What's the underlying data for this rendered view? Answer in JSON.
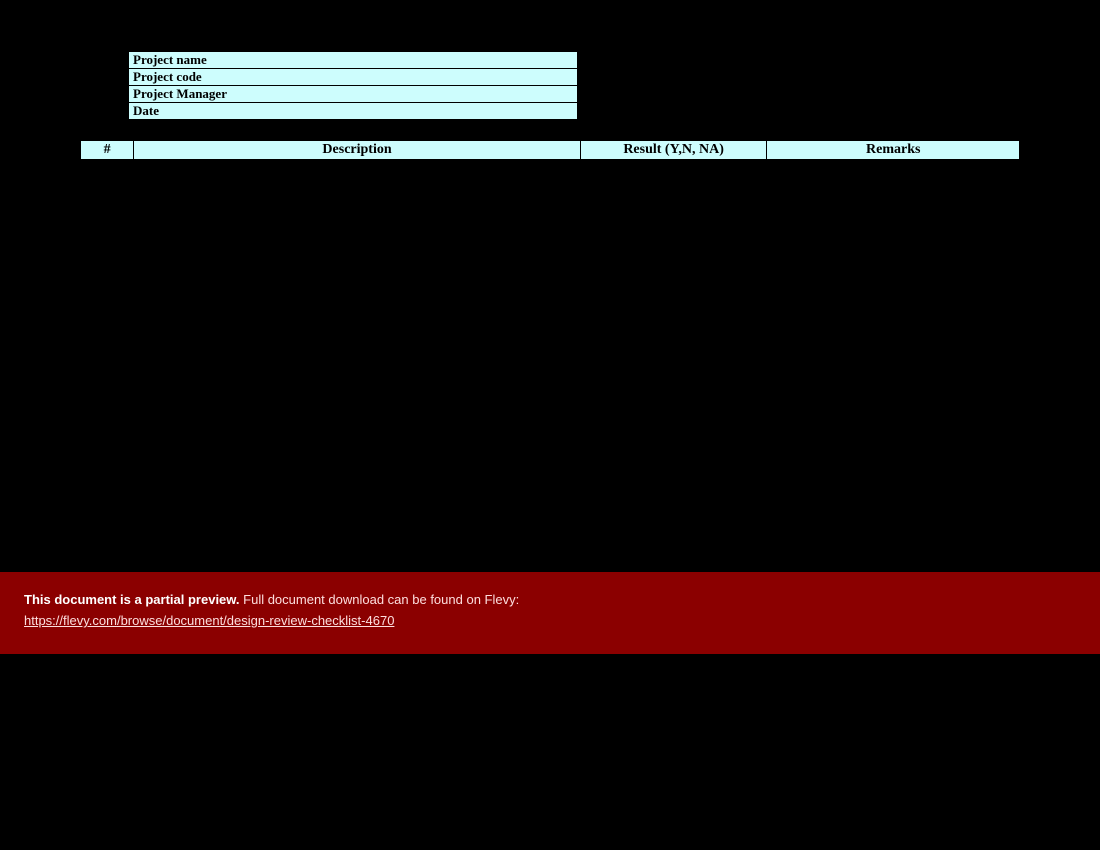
{
  "info": {
    "label_project_name": "Project name",
    "label_project_code": "Project code",
    "label_project_manager": "Project Manager",
    "label_date": "Date"
  },
  "checklist_headers": {
    "num": "#",
    "description": "Description",
    "result": "Result (Y,N, NA)",
    "remarks": "Remarks"
  },
  "banner": {
    "bold": "This document is a partial preview.",
    "rest": "  Full document download can be found on Flevy:",
    "link_text": "https://flevy.com/browse/document/design-review-checklist-4670"
  }
}
